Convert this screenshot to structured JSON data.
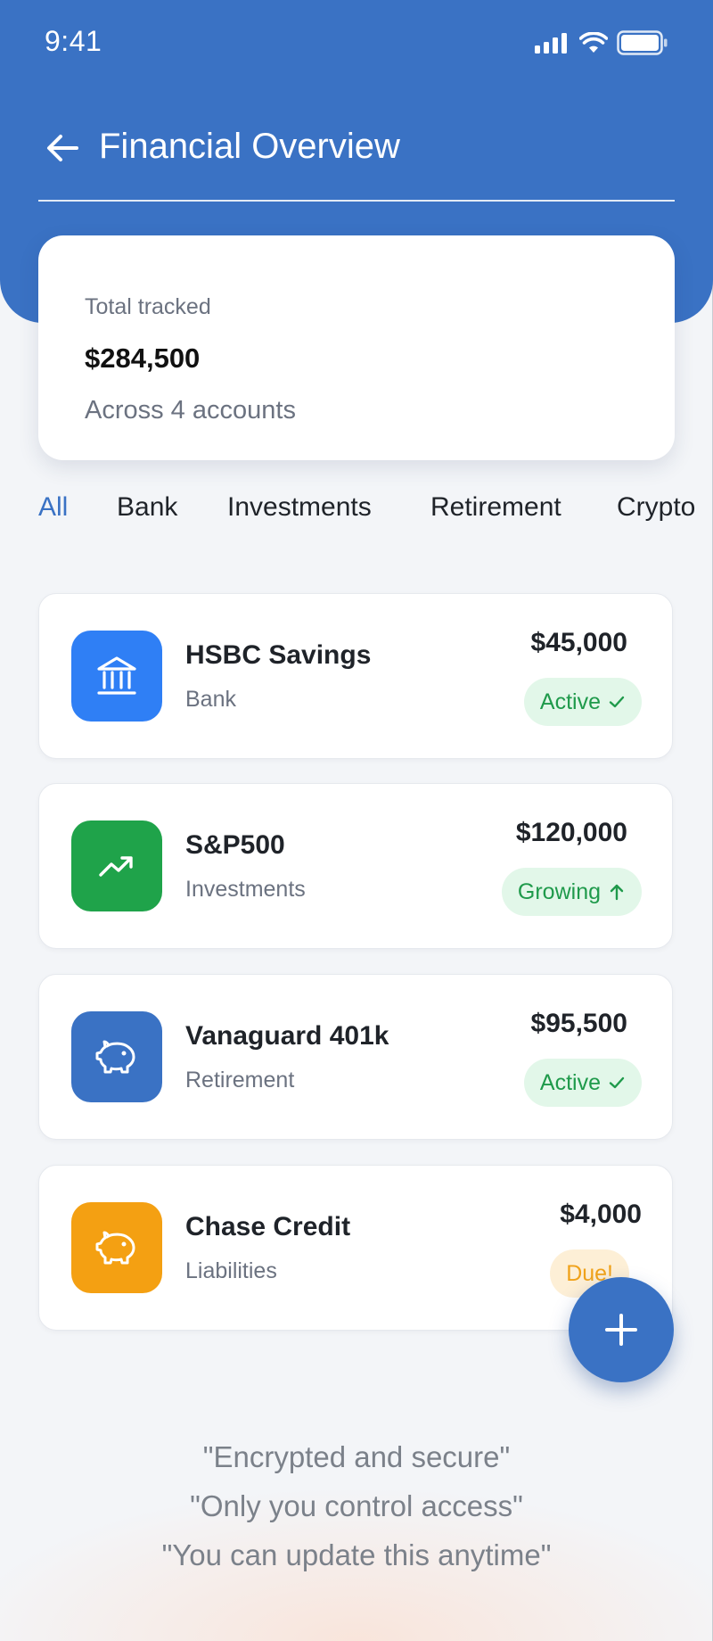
{
  "status_bar": {
    "time": "9:41"
  },
  "header": {
    "title": "Financial Overview"
  },
  "summary": {
    "label": "Total tracked",
    "amount": "$284,500",
    "subtitle": "Across 4 accounts"
  },
  "tabs": [
    {
      "label": "All",
      "active": true
    },
    {
      "label": "Bank"
    },
    {
      "label": "Investments"
    },
    {
      "label": "Retirement"
    },
    {
      "label": "Crypto"
    }
  ],
  "accounts": [
    {
      "name": "HSBC Savings",
      "type": "Bank",
      "amount": "$45,000",
      "badge": "Active",
      "badge_icon": "check-icon",
      "icon": "bank-icon",
      "icon_color": "#2f7ff5"
    },
    {
      "name": "S&P500",
      "type": "Investments",
      "amount": "$120,000",
      "badge": "Growing",
      "badge_icon": "arrow-up-icon",
      "icon": "trending-up-icon",
      "icon_color": "#1fa34a"
    },
    {
      "name": "Vanaguard 401k",
      "type": "Retirement",
      "amount": "$95,500",
      "badge": "Active",
      "badge_icon": "check-icon",
      "icon": "piggy-bank-icon",
      "icon_color": "#3a72c4"
    },
    {
      "name": "Chase Credit",
      "type": "Liabilities",
      "amount": "$4,000",
      "badge": "Due!",
      "icon": "piggy-bank-icon",
      "icon_color": "#f4a012"
    }
  ],
  "quotes": [
    "\"Encrypted and secure\"",
    "\"Only you control access\"",
    "\"You can update this anytime\""
  ],
  "colors": {
    "primary": "#3a72c4",
    "success": "#1f9a4b",
    "warning": "#f0a21a"
  }
}
